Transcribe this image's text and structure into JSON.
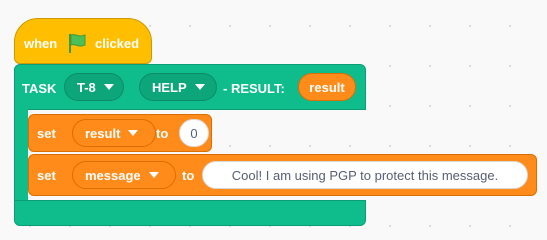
{
  "hat_block": {
    "when_label": "when",
    "flag_icon": "green-flag-icon",
    "clicked_label": "clicked"
  },
  "task_block": {
    "task_label": "TASK",
    "task_dropdown": "T-8",
    "help_dropdown": "HELP",
    "result_label": "- RESULT:",
    "result_reporter": "result"
  },
  "set_result_block": {
    "set_label": "set",
    "variable_dropdown": "result",
    "to_label": "to",
    "value": "0"
  },
  "set_message_block": {
    "set_label": "set",
    "variable_dropdown": "message",
    "to_label": "to",
    "value": "Cool! I am using PGP to protect this message."
  },
  "colors": {
    "events": "#ffbf00",
    "custom": "#0fbd8c",
    "variables": "#ff8c1a"
  }
}
